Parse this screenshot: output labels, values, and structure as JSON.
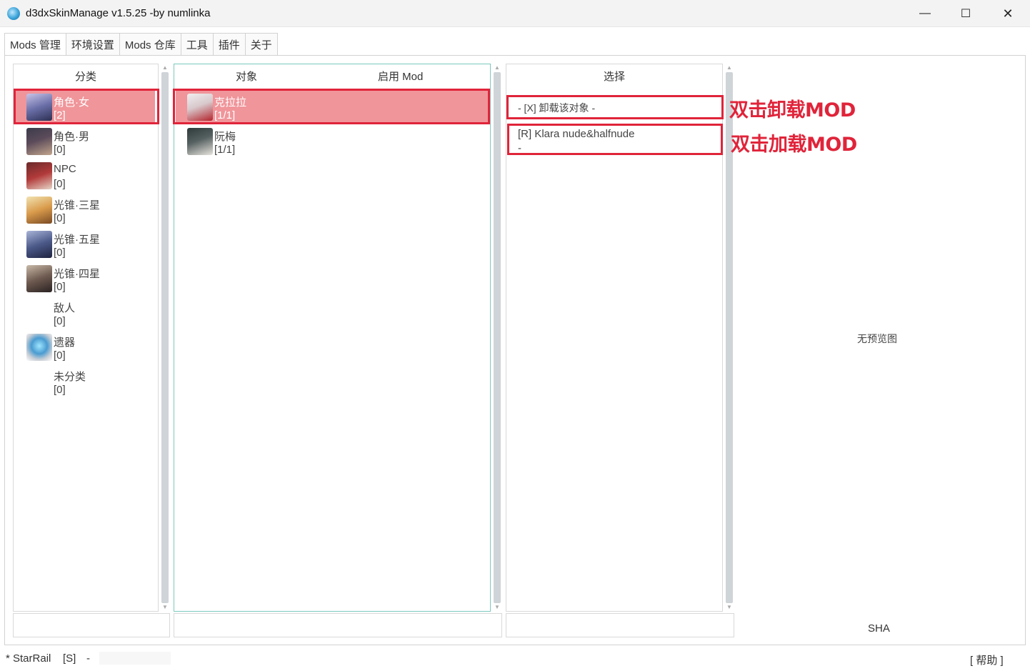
{
  "window": {
    "title": "d3dxSkinManage v1.5.25 -by numlinka",
    "minimize_glyph": "—",
    "maximize_glyph": "☐",
    "close_glyph": "✕"
  },
  "tabs": [
    {
      "label": "Mods 管理",
      "active": true
    },
    {
      "label": "环境设置"
    },
    {
      "label": "Mods 仓库"
    },
    {
      "label": "工具"
    },
    {
      "label": "插件"
    },
    {
      "label": "关于"
    }
  ],
  "categories": {
    "header": "分类",
    "items": [
      {
        "name": "角色·女",
        "count": "[2]",
        "selected": true,
        "icon": "female-character-thumbnail"
      },
      {
        "name": "角色·男",
        "count": "[0]",
        "icon": "male-character-thumbnail"
      },
      {
        "name": "NPC",
        "count": "[0]",
        "icon": "npc-thumbnail"
      },
      {
        "name": "光锥·三星",
        "count": "[0]",
        "icon": "light-cone-3star-thumbnail"
      },
      {
        "name": "光锥·五星",
        "count": "[0]",
        "icon": "light-cone-5star-thumbnail"
      },
      {
        "name": "光锥·四星",
        "count": "[0]",
        "icon": "light-cone-4star-thumbnail"
      },
      {
        "name": "敌人",
        "count": "[0]",
        "icon": ""
      },
      {
        "name": "遗器",
        "count": "[0]",
        "icon": "relic-thumbnail"
      },
      {
        "name": "未分类",
        "count": "[0]",
        "icon": ""
      }
    ]
  },
  "objects": {
    "header_object": "对象",
    "header_mod": "启用 Mod",
    "items": [
      {
        "name": "克拉拉",
        "count": "[1/1]",
        "selected": true,
        "icon": "clara-thumbnail"
      },
      {
        "name": "阮梅",
        "count": "[1/1]",
        "icon": "ruan-mei-thumbnail"
      }
    ]
  },
  "selection": {
    "header": "选择",
    "items": [
      {
        "line1": "- [X] 卸载该对象 -"
      },
      {
        "line1": "[R] Klara nude&halfnude",
        "line2": "-"
      }
    ]
  },
  "annotations": {
    "unload": "双击卸载MOD",
    "load": "双击加载MOD"
  },
  "preview": {
    "no_preview": "无预览图",
    "sha_label": "SHA"
  },
  "status": {
    "game": "* StarRail",
    "mode": "[S]",
    "sep": "-",
    "help": "[ 帮助 ]"
  },
  "colors": {
    "selected_row": "#f0959a",
    "annotation_red": "#e0243a",
    "object_panel_border": "#7cc9be"
  }
}
